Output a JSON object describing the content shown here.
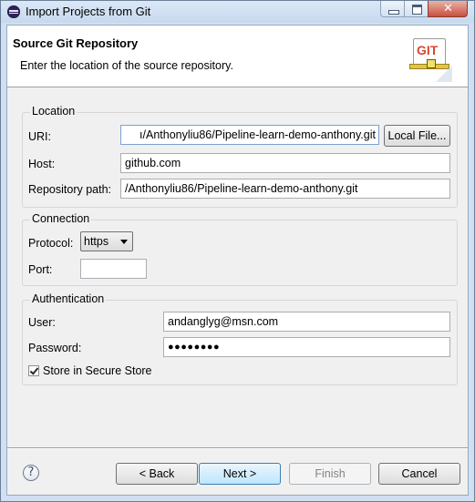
{
  "window": {
    "title": "Import Projects from Git",
    "close_glyph": "✕"
  },
  "banner": {
    "title": "Source Git Repository",
    "description": "Enter the location of the source repository.",
    "logo_text": "GIT"
  },
  "location": {
    "title": "Location",
    "uri_label": "URI:",
    "uri_value": "ı/Anthonyliu86/Pipeline-learn-demo-anthony.git",
    "local_file_button": "Local File...",
    "host_label": "Host:",
    "host_value": "github.com",
    "path_label": "Repository path:",
    "path_value": "/Anthonyliu86/Pipeline-learn-demo-anthony.git"
  },
  "connection": {
    "title": "Connection",
    "protocol_label": "Protocol:",
    "protocol_value": "https",
    "port_label": "Port:",
    "port_value": ""
  },
  "authentication": {
    "title": "Authentication",
    "user_label": "User:",
    "user_value": "andanglyg@msn.com",
    "password_label": "Password:",
    "password_value": "●●●●●●●●",
    "store_label": "Store in Secure Store",
    "store_checked": true
  },
  "footer": {
    "help_glyph": "?",
    "back": "< Back",
    "next": "Next >",
    "finish": "Finish",
    "cancel": "Cancel"
  }
}
